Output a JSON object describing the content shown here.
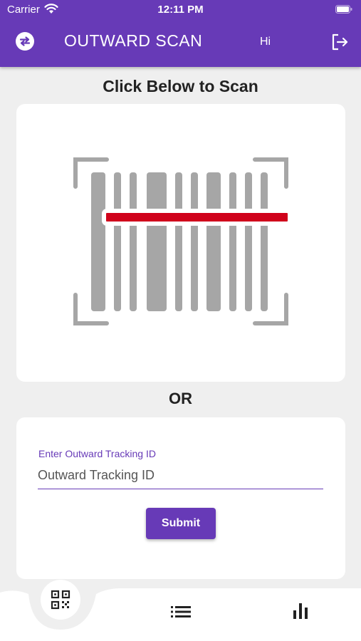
{
  "status_bar": {
    "carrier": "Carrier",
    "time": "12:11 PM"
  },
  "appbar": {
    "title": "OUTWARD SCAN",
    "greeting": "Hi",
    "left_icon": "swap-arrows-icon",
    "right_icon": "logout-icon"
  },
  "main": {
    "heading": "Click Below to Scan",
    "separator": "OR",
    "scan_icon": "barcode-scanner-icon"
  },
  "form": {
    "label": "Enter Outward Tracking ID",
    "placeholder": "Outward Tracking ID",
    "value": "",
    "submit_label": "Submit"
  },
  "bottom_nav": {
    "items": [
      {
        "icon": "qr-scan-icon",
        "active": true
      },
      {
        "icon": "list-icon",
        "active": false
      },
      {
        "icon": "bar-chart-icon",
        "active": false
      }
    ]
  },
  "colors": {
    "primary": "#673ab7",
    "background": "#efefef",
    "scan_line": "#d0021b",
    "barcode": "#a6a6a6"
  }
}
